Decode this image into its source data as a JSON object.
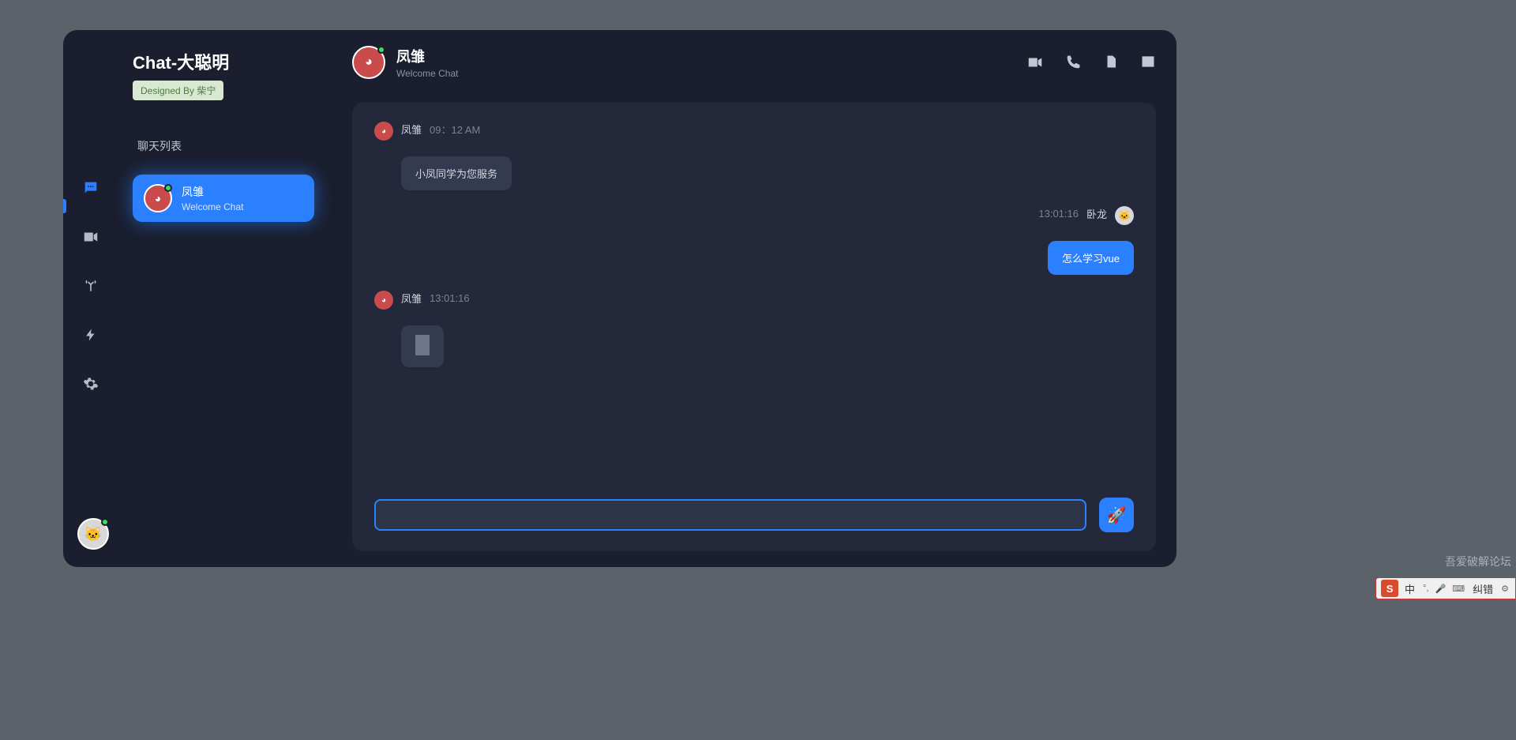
{
  "app": {
    "title": "Chat-大聪明",
    "designed_by": "Designed By 柴宁"
  },
  "sidebar": {
    "list_header": "聊天列表",
    "contacts": [
      {
        "name": "凤雏",
        "subtitle": "Welcome Chat"
      }
    ]
  },
  "chat": {
    "header": {
      "title": "凤雏",
      "subtitle": "Welcome Chat"
    },
    "messages": [
      {
        "side": "left",
        "author": "凤雏",
        "time": "09：12 AM",
        "text": "小凤同学为您服务",
        "avatar": "bot"
      },
      {
        "side": "right",
        "author": "卧龙",
        "time": "13:01:16",
        "text": "怎么学习vue",
        "avatar": "cat"
      },
      {
        "side": "left",
        "author": "凤雏",
        "time": "13:01:16",
        "text": "",
        "avatar": "bot",
        "loading": true
      }
    ],
    "input": {
      "value": "",
      "placeholder": ""
    }
  },
  "watermark": "吾爱破解论坛",
  "ime": {
    "logo": "S",
    "mode": "中",
    "extra": "纠错"
  }
}
